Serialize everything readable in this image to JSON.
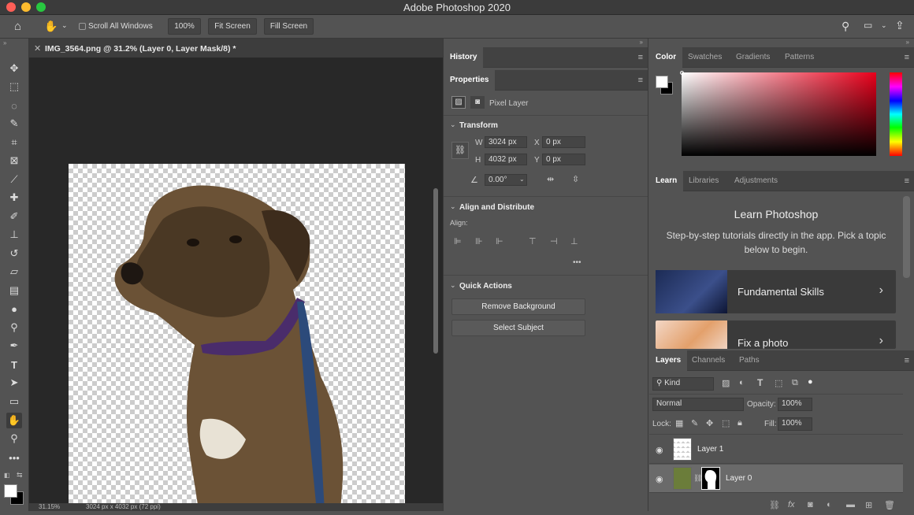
{
  "window": {
    "title": "Adobe Photoshop 2020"
  },
  "options_bar": {
    "scroll_all_windows": "Scroll All Windows",
    "zoom_button": "100%",
    "fit_screen": "Fit Screen",
    "fill_screen": "Fill Screen"
  },
  "document": {
    "tab_title": "IMG_3564.png @ 31.2% (Layer 0, Layer Mask/8) *",
    "status_zoom": "31.15%",
    "status_info": "3024 px x 4032 px (72 ppi)"
  },
  "history_panel": {
    "tab": "History"
  },
  "properties_panel": {
    "tab": "Properties",
    "layer_type": "Pixel Layer",
    "transform": {
      "title": "Transform",
      "w_label": "W",
      "w_value": "3024 px",
      "h_label": "H",
      "h_value": "4032 px",
      "x_label": "X",
      "x_value": "0 px",
      "y_label": "Y",
      "y_value": "0 px",
      "angle": "0.00°"
    },
    "align": {
      "title": "Align and Distribute",
      "label": "Align:",
      "more": "•••"
    },
    "quick_actions": {
      "title": "Quick Actions",
      "remove_bg": "Remove Background",
      "select_subject": "Select Subject"
    }
  },
  "color_panel": {
    "tabs": [
      "Color",
      "Swatches",
      "Gradients",
      "Patterns"
    ],
    "foreground": "#ffffff",
    "background": "#000000",
    "hue": "#e8001b"
  },
  "learn_panel": {
    "tabs": [
      "Learn",
      "Libraries",
      "Adjustments"
    ],
    "title": "Learn Photoshop",
    "description": "Step-by-step tutorials directly in the app. Pick a topic below to begin.",
    "cards": [
      {
        "label": "Fundamental Skills"
      },
      {
        "label": "Fix a photo"
      }
    ]
  },
  "layers_panel": {
    "tabs": [
      "Layers",
      "Channels",
      "Paths"
    ],
    "filter_kind": "Kind",
    "blend_mode": "Normal",
    "opacity_label": "Opacity:",
    "opacity_value": "100%",
    "lock_label": "Lock:",
    "fill_label": "Fill:",
    "fill_value": "100%",
    "layers": [
      {
        "name": "Layer 1"
      },
      {
        "name": "Layer 0"
      }
    ]
  },
  "colors": {
    "panel_bg": "#535353",
    "dark": "#282828",
    "accent_red": "#e8001b"
  }
}
